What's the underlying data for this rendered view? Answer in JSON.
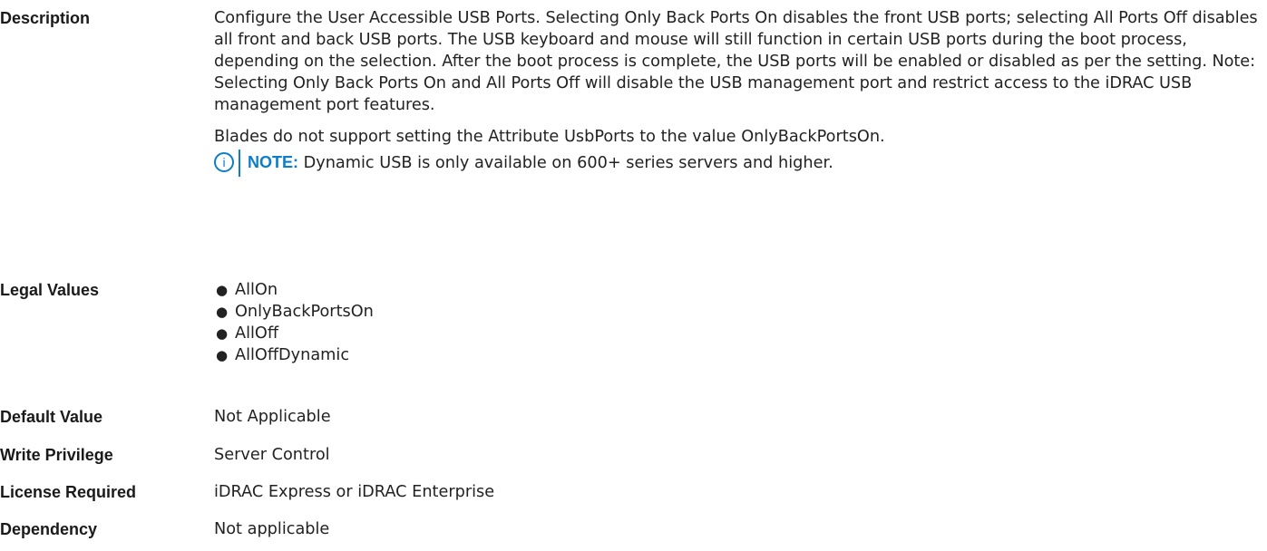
{
  "rows": {
    "description": {
      "label": "Description",
      "paragraph1": "Configure the User Accessible USB Ports. Selecting Only Back Ports On disables the front USB ports; selecting All Ports Off disables all front and back USB ports. The USB keyboard and mouse will still function in certain USB ports during the boot process, depending on the selection. After the boot process is complete, the USB ports will be enabled or disabled as per the setting. Note: Selecting Only Back Ports On and All Ports Off will disable the USB management port and restrict access to the iDRAC USB management port features.",
      "paragraph2": "Blades do not support setting the Attribute UsbPorts to the value OnlyBackPortsOn.",
      "note": {
        "icon": "info-icon",
        "icon_glyph": "i",
        "label": "NOTE:",
        "text": " Dynamic USB is only available on 600+ series servers and higher."
      }
    },
    "legal_values": {
      "label": "Legal Values",
      "bullet": "●",
      "items": [
        "AllOn",
        "OnlyBackPortsOn",
        "AllOff",
        "AllOffDynamic"
      ]
    },
    "default_value": {
      "label": "Default Value",
      "value": "Not Applicable"
    },
    "write_privilege": {
      "label": "Write Privilege",
      "value": "Server Control"
    },
    "license_required": {
      "label": "License Required",
      "value": "iDRAC Express or iDRAC Enterprise"
    },
    "dependency": {
      "label": "Dependency",
      "value": "Not applicable"
    }
  },
  "colors": {
    "note_accent": "#0b7ec7",
    "text": "#1a1a1a"
  }
}
